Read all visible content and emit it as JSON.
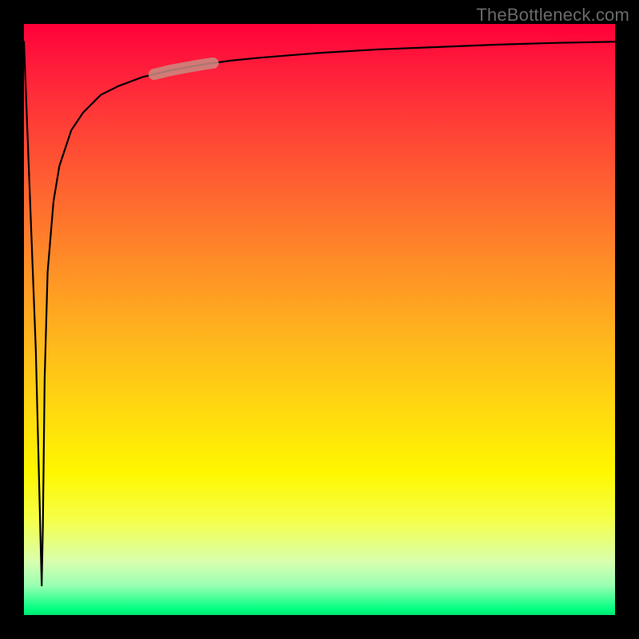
{
  "watermark": "TheBottleneck.com",
  "chart_data": {
    "type": "line",
    "title": "",
    "xlabel": "",
    "ylabel": "",
    "xlim": [
      0,
      100
    ],
    "ylim": [
      0,
      100
    ],
    "background_gradient": {
      "top": "#ff003a",
      "middle": "#fff700",
      "bottom": "#00ff80"
    },
    "series": [
      {
        "name": "bottleneck-curve",
        "x": [
          0,
          2,
          3,
          3.2,
          3.5,
          4,
          5,
          6,
          8,
          10,
          13,
          16,
          20,
          25,
          30,
          35,
          40,
          50,
          60,
          70,
          80,
          90,
          100
        ],
        "y": [
          97,
          45,
          5,
          15,
          40,
          58,
          70,
          76,
          82,
          85,
          88,
          89.5,
          91,
          92.2,
          93.1,
          93.8,
          94.3,
          95.1,
          95.7,
          96.1,
          96.5,
          96.8,
          97.0
        ],
        "highlight_range_x": [
          22,
          32
        ]
      }
    ]
  }
}
